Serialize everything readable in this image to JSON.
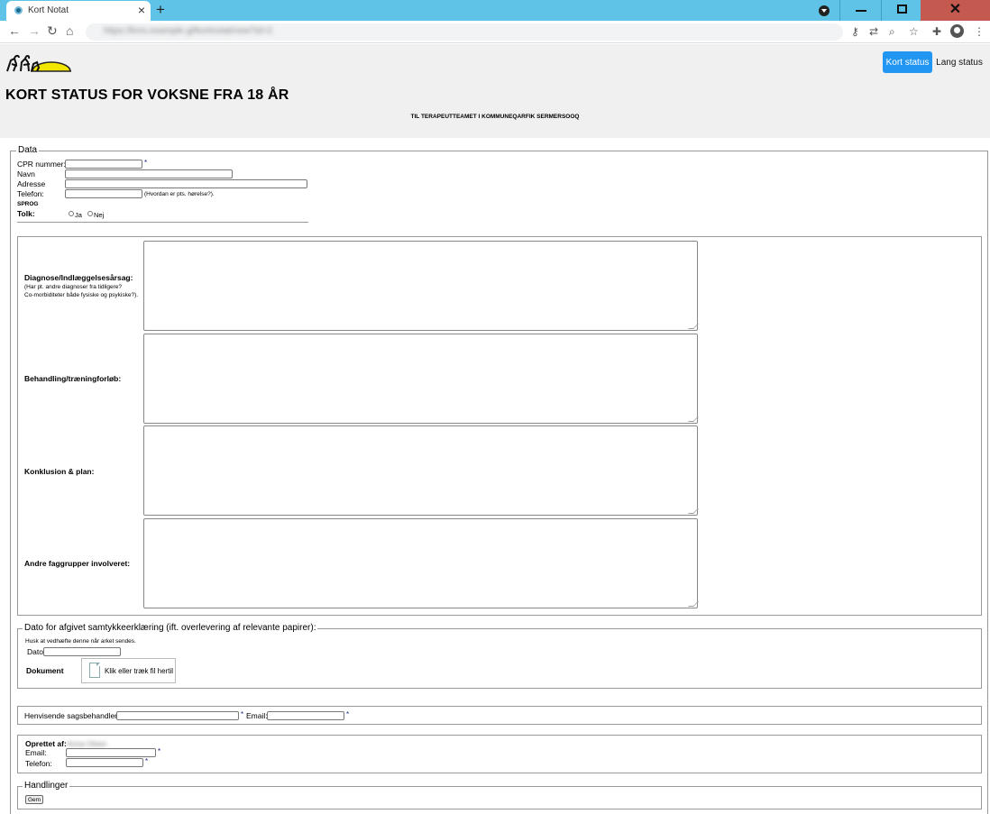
{
  "browser": {
    "tab_title": "Kort Notat",
    "tab_close": "×",
    "new_tab": "+",
    "url": "https://kms.example.gl/kortnotat/new?id=2"
  },
  "header": {
    "title": "KORT STATUS FOR VOKSNE FRA 18 ÅR",
    "subtitle": "TIL TERAPEUTTEAMET I KOMMUNEQARFIK SERMERSOOQ",
    "btn_kort": "Kort status",
    "btn_lang": "Lang status"
  },
  "data_section": {
    "legend": "Data",
    "cpr_label": "CPR nummer:",
    "navn_label": "Navn",
    "adresse_label": "Adresse",
    "telefon_label": "Telefon:",
    "telefon_hint": "(Hvordan er pts. hørelse?).",
    "sprog_label": "SPROG",
    "tolk_label": "Tolk:",
    "ja": "Ja",
    "nej": "Nej",
    "required": "*"
  },
  "clinical": {
    "diagnose_label": "Diagnose/Indlæggelsesårsag:",
    "diagnose_hint1": "(Har pt. andre diagnoser fra tidligere?",
    "diagnose_hint2": "Co-morbiditeter både fysiske og psykiske?).",
    "behandling_label": "Behandling/træningforløb:",
    "konklusion_label": "Konklusion & plan:",
    "andre_label": "Andre faggrupper involveret:"
  },
  "consent": {
    "legend": "Dato for afgivet samtykkeerklæring (ift. overlevering af relevante papirer):",
    "hint": "Husk at vedhæfte denne når arket sendes.",
    "dato_label": "Dato",
    "dokument_label": "Dokument",
    "upload_text": "Klik eller træk fil hertil"
  },
  "referral": {
    "handler_label": "Henvisende sagsbehandler:",
    "email_label": "Email:"
  },
  "creator": {
    "oprettet_label": "Oprettet af:",
    "name": "Anna Olsen",
    "email_label": "Email:",
    "telefon_label": "Telefon:"
  },
  "actions": {
    "legend": "Handlinger",
    "gem": "Gem"
  }
}
